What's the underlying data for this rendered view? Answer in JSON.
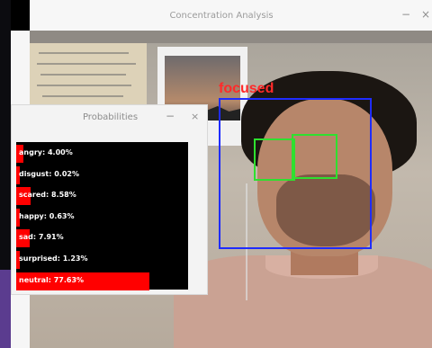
{
  "main_window": {
    "title": "Concentration Analysis",
    "minimize_glyph": "−",
    "close_glyph": "×"
  },
  "detection": {
    "label": "focused",
    "label_color": "#ff2a2a",
    "face_box_color": "#1f2cff",
    "eye_box_color": "#2fe02f"
  },
  "probabilities_window": {
    "title": "Probabilities",
    "minimize_glyph": "−",
    "close_glyph": "×",
    "items": [
      {
        "text": "angry: 4.00%",
        "value": 4.0
      },
      {
        "text": "disgust: 0.02%",
        "value": 0.02
      },
      {
        "text": "scared: 8.58%",
        "value": 8.58
      },
      {
        "text": "happy: 0.63%",
        "value": 0.63
      },
      {
        "text": "sad: 7.91%",
        "value": 7.91
      },
      {
        "text": "surprised: 1.23%",
        "value": 1.23
      },
      {
        "text": "neutral: 77.63%",
        "value": 77.63
      }
    ]
  }
}
